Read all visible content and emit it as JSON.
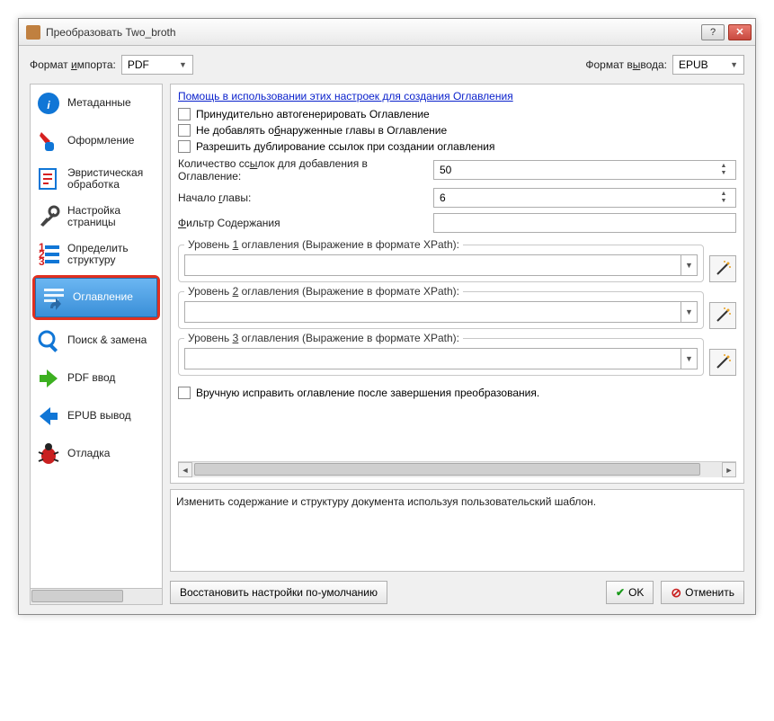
{
  "window": {
    "title": "Преобразовать Two_broth"
  },
  "topbar": {
    "import_label": "Формат импорта:",
    "import_value": "PDF",
    "output_label": "Формат вывода:",
    "output_value": "EPUB"
  },
  "sidebar": {
    "items": [
      {
        "label": "Метаданные"
      },
      {
        "label": "Оформление"
      },
      {
        "label": "Эвристическая обработка"
      },
      {
        "label": "Настройка страницы"
      },
      {
        "label": "Определить структуру"
      },
      {
        "label": "Оглавление"
      },
      {
        "label": "Поиск & замена"
      },
      {
        "label": "PDF ввод"
      },
      {
        "label": "EPUB вывод"
      },
      {
        "label": "Отладка"
      }
    ]
  },
  "main": {
    "help_link": "Помощь в использовании этих настроек для создания Оглавления",
    "chk_force": "Принудительно автогенерировать Оглавление",
    "chk_nodup": "Не добавлять обнаруженные главы в Оглавление",
    "chk_allowdup": "Разрешить дублирование ссылок при создании оглавления",
    "links_label": "Количество ссылок для добавления в Оглавление:",
    "links_value": "50",
    "chapter_label": "Начало главы:",
    "chapter_value": "6",
    "filter_label": "Фильтр Содержания",
    "level1_label": "Уровень 1 оглавления (Выражение в формате XPath):",
    "level2_label": "Уровень 2 оглавления (Выражение в формате XPath):",
    "level3_label": "Уровень 3 оглавления (Выражение в формате XPath):",
    "manual_label": "Вручную исправить оглавление после завершения преобразования."
  },
  "desc": "Изменить содержание и структуру документа используя пользовательский шаблон.",
  "buttons": {
    "restore": "Восстановить настройки по-умолчанию",
    "ok": "OK",
    "cancel": "Отменить"
  }
}
